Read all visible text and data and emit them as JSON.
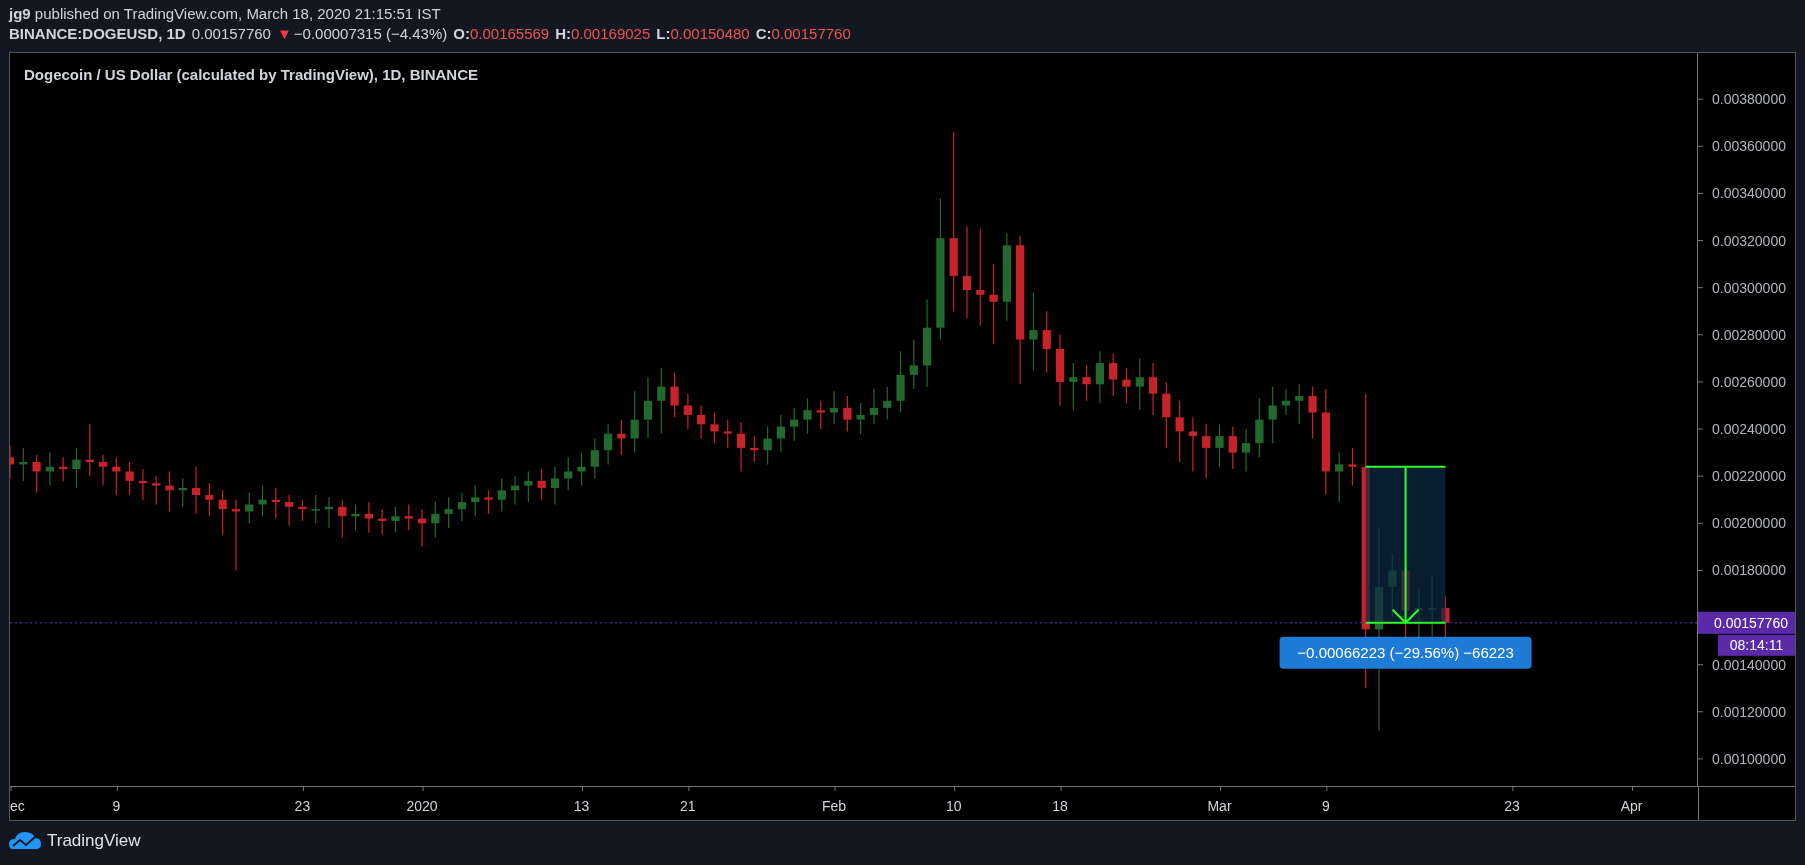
{
  "header": {
    "byline": "**jg9** published on TradingView.com, March 18, 2020 21:15:51 IST",
    "symbol": "BINANCE:DOGEUSD, 1D",
    "price": "0.00157760",
    "change_icon": "▼",
    "change": "−0.00007315 (−4.43%)",
    "ohlc": [
      {
        "label": "O:",
        "value": "0.00165569"
      },
      {
        "label": "H:",
        "value": "0.00169025"
      },
      {
        "label": "L:",
        "value": "0.00150480"
      },
      {
        "label": "C:",
        "value": "0.00157760"
      }
    ]
  },
  "chart": {
    "title": "Dogecoin / US Dollar (calculated by TradingView), 1D, BINANCE",
    "price_label": "0.00157760",
    "countdown": "08:14:11",
    "measure_label": "−0.00066223 (−29.56%) −66223",
    "price_axis": [
      "0.00380000",
      "0.00360000",
      "0.00340000",
      "0.00320000",
      "0.00300000",
      "0.00280000",
      "0.00260000",
      "0.00240000",
      "0.00220000",
      "0.00200000",
      "0.00180000",
      "0.00140000",
      "0.00120000",
      "0.00100000"
    ],
    "time_axis": [
      "ec",
      "9",
      "23",
      "2020",
      "13",
      "21",
      "Feb",
      "10",
      "18",
      "Mar",
      "9",
      "23",
      "Apr"
    ]
  },
  "footer": {
    "brand": "TradingView"
  }
}
